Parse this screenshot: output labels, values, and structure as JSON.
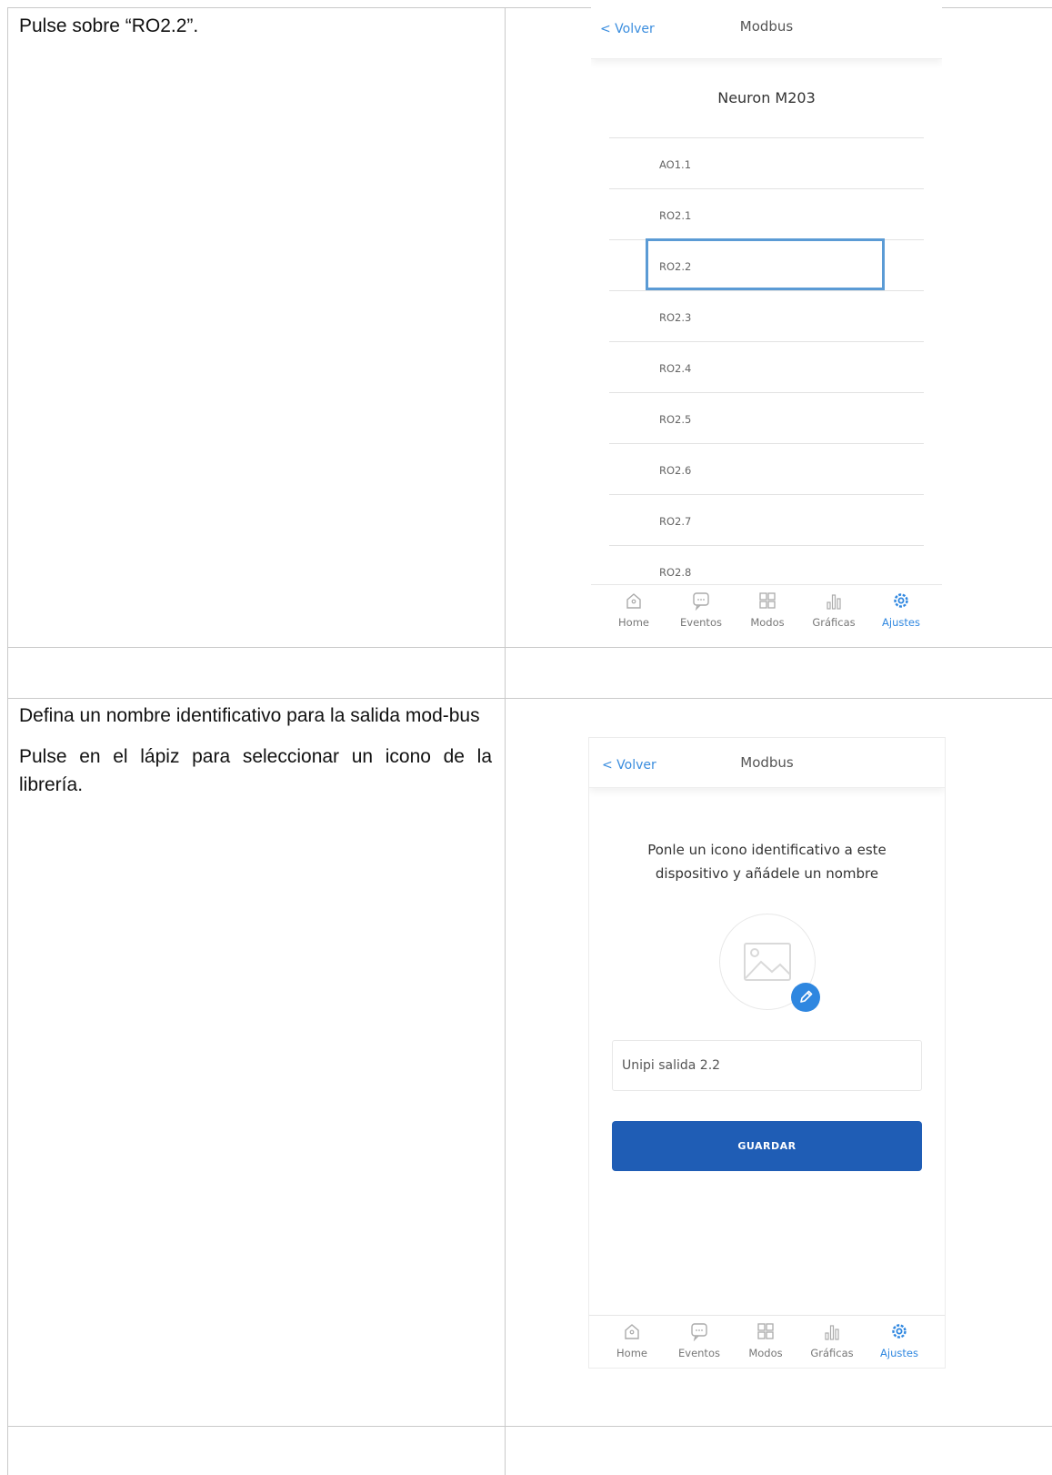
{
  "step1": {
    "instruction": "Pulse sobre “RO2.2”.",
    "screen": {
      "back_label": "< Volver",
      "title": "Modbus",
      "device_name": "Neuron M203",
      "items": [
        {
          "label": "AO1.1"
        },
        {
          "label": "RO2.1"
        },
        {
          "label": "RO2.2",
          "highlighted": true
        },
        {
          "label": "RO2.3"
        },
        {
          "label": "RO2.4"
        },
        {
          "label": "RO2.5"
        },
        {
          "label": "RO2.6"
        },
        {
          "label": "RO2.7"
        },
        {
          "label": "RO2.8"
        }
      ]
    }
  },
  "step2": {
    "instruction_1": "Defina un nombre identificativo para la salida mod-bus",
    "instruction_2": "Pulse en el lápiz para seleccionar un icono de la librería.",
    "screen": {
      "back_label": "< Volver",
      "title": "Modbus",
      "prompt": "Ponle un icono identificativo a este dispositivo y añádele un nombre",
      "name_value": "Unipi salida 2.2",
      "save_label": "GUARDAR",
      "image_placeholder_icon": "image-icon",
      "edit_icon": "pencil-icon"
    }
  },
  "tabbar": {
    "tabs": [
      {
        "label": "Home",
        "icon": "home-icon"
      },
      {
        "label": "Eventos",
        "icon": "chat-bubble-icon"
      },
      {
        "label": "Modos",
        "icon": "grid-icon"
      },
      {
        "label": "Gráficas",
        "icon": "bar-chart-icon"
      },
      {
        "label": "Ajustes",
        "icon": "settings-gear-icon",
        "active": true
      }
    ]
  },
  "colors": {
    "accent": "#2f87e0",
    "button": "#1f5db5",
    "highlight_border": "#5b9bd5"
  }
}
